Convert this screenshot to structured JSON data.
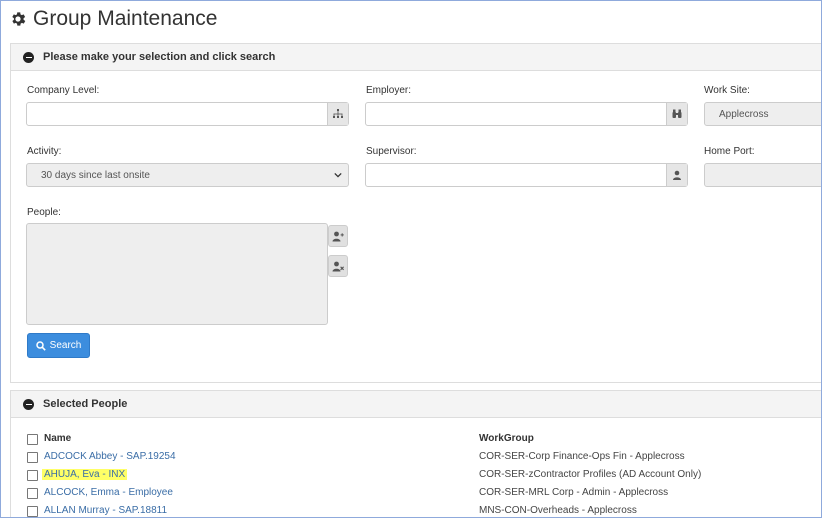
{
  "page": {
    "title": "Group Maintenance"
  },
  "search_panel": {
    "header": "Please make your selection and click search",
    "company_level_label": "Company Level:",
    "employer_label": "Employer:",
    "work_site_label": "Work Site:",
    "work_site_value": "Applecross",
    "activity_label": "Activity:",
    "activity_value": "30 days since last onsite",
    "supervisor_label": "Supervisor:",
    "home_port_label": "Home Port:",
    "people_label": "People:",
    "search_button": "Search"
  },
  "selected_panel": {
    "header": "Selected People",
    "columns": {
      "name": "Name",
      "workgroup": "WorkGroup"
    },
    "rows": [
      {
        "name": "ADCOCK Abbey - SAP.19254",
        "workgroup": "COR-SER-Corp Finance-Ops Fin - Applecross",
        "highlighted": false
      },
      {
        "name": "AHUJA, Eva - INX",
        "workgroup": "COR-SER-zContractor Profiles (AD Account Only)",
        "highlighted": true
      },
      {
        "name": "ALCOCK, Emma - Employee",
        "workgroup": "COR-SER-MRL Corp - Admin - Applecross",
        "highlighted": false
      },
      {
        "name": "ALLAN Murray - SAP.18811",
        "workgroup": "MNS-CON-Overheads - Applecross",
        "highlighted": false
      }
    ]
  },
  "colors": {
    "link": "#3a6da6",
    "primary": "#3c8dde",
    "highlight": "#ffff66"
  }
}
